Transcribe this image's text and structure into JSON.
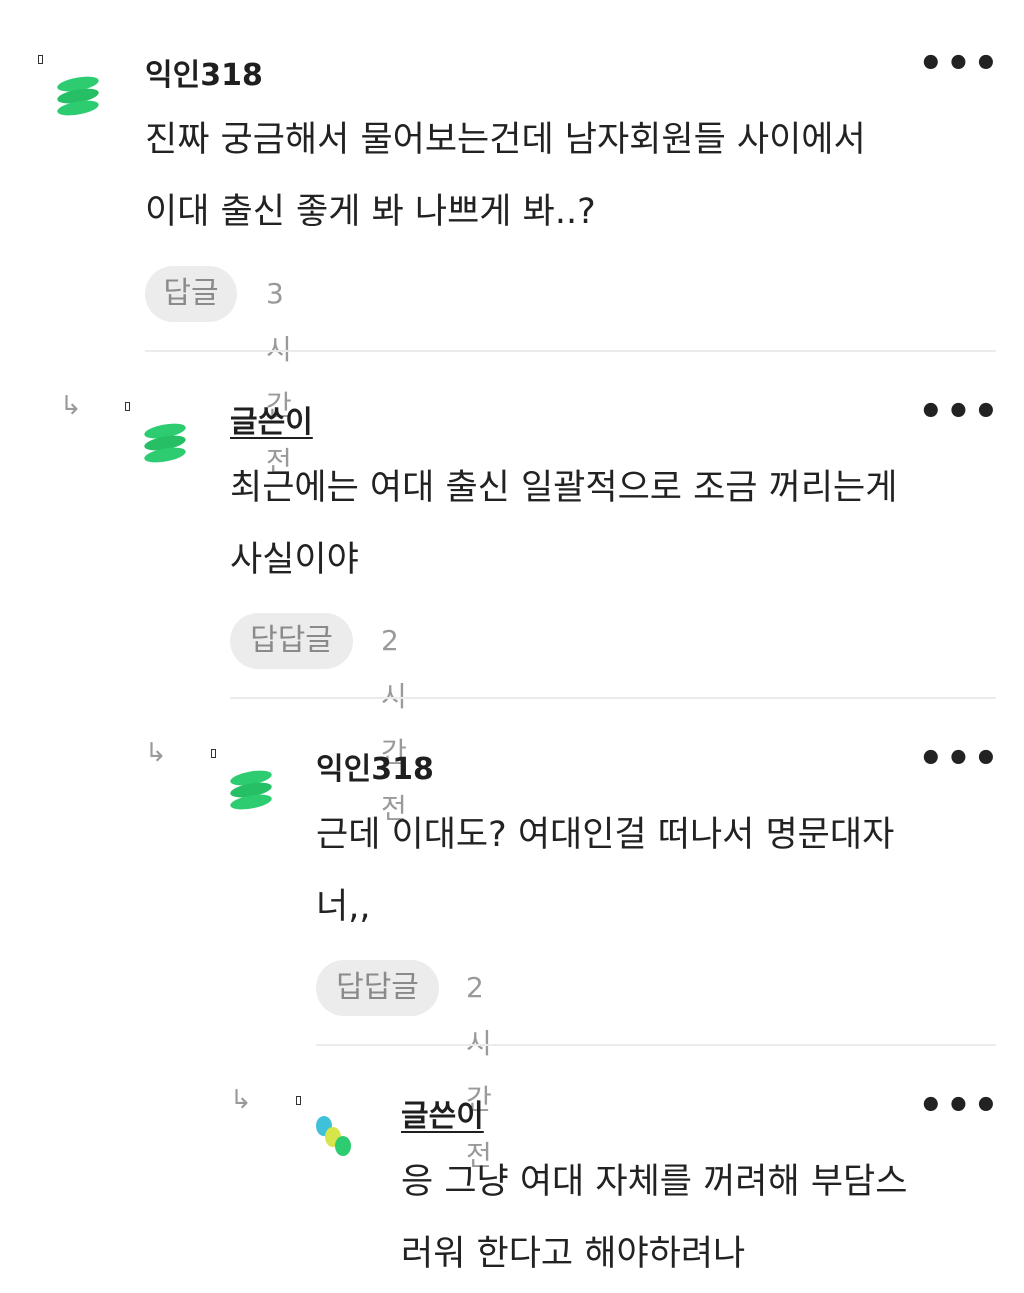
{
  "comments": [
    {
      "author": "익인318",
      "lines": [
        "진짜 궁금해서 물어보는건데 남자회원들 사이에서",
        "이대 출신 좋게 봐 나쁘게 봐..?"
      ],
      "reply_label": "답글",
      "time": "3시간전",
      "more": "•••"
    },
    {
      "author": "글쓴이",
      "lines": [
        "최근에는 여대 출신 일괄적으로 조금 꺼리는게",
        "사실이야"
      ],
      "reply_label": "답답글",
      "time": "2시간전",
      "more": "•••",
      "arrow": "↳"
    },
    {
      "author": "익인318",
      "lines": [
        "근데 이대도? 여대인걸 떠나서 명문대자",
        "너,,"
      ],
      "reply_label": "답답글",
      "time": "2시간전",
      "more": "•••",
      "arrow": "↳"
    },
    {
      "author": "글쓴이",
      "lines": [
        "응 그냥 여대 자체를 꺼려해 부담스",
        "러워 한다고 해야하려나"
      ],
      "more": "•••",
      "arrow": "↳"
    }
  ],
  "colors": {
    "avatar_green": "#2ecc71",
    "avatar_green_dark": "#20b45e",
    "avatar_cyan": "#3fc1d9",
    "avatar_yellow": "#d6e64a",
    "pill_bg": "#ececec",
    "meta_gray": "#9a9a9a"
  }
}
